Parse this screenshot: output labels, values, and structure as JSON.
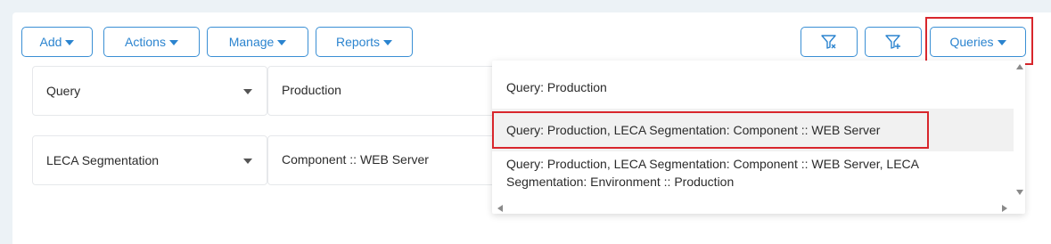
{
  "toolbar": {
    "add_label": "Add",
    "actions_label": "Actions",
    "manage_label": "Manage",
    "reports_label": "Reports",
    "queries_label": "Queries",
    "clear_filter_icon": "filter-clear-icon",
    "add_filter_icon": "filter-add-icon"
  },
  "filters": [
    {
      "field": "Query",
      "value": "Production"
    },
    {
      "field": "LECA Segmentation",
      "value": "Component :: WEB Server"
    }
  ],
  "queries_menu": {
    "options": [
      "Query: Production",
      "Query: Production, LECA Segmentation: Component :: WEB Server",
      "Query: Production, LECA Segmentation: Component :: WEB Server, LECA Segmentation: Environment :: Production"
    ]
  },
  "colors": {
    "accent": "#2b84cf",
    "highlight_border": "#d8262c",
    "hover_row": "#f1f1f1"
  }
}
